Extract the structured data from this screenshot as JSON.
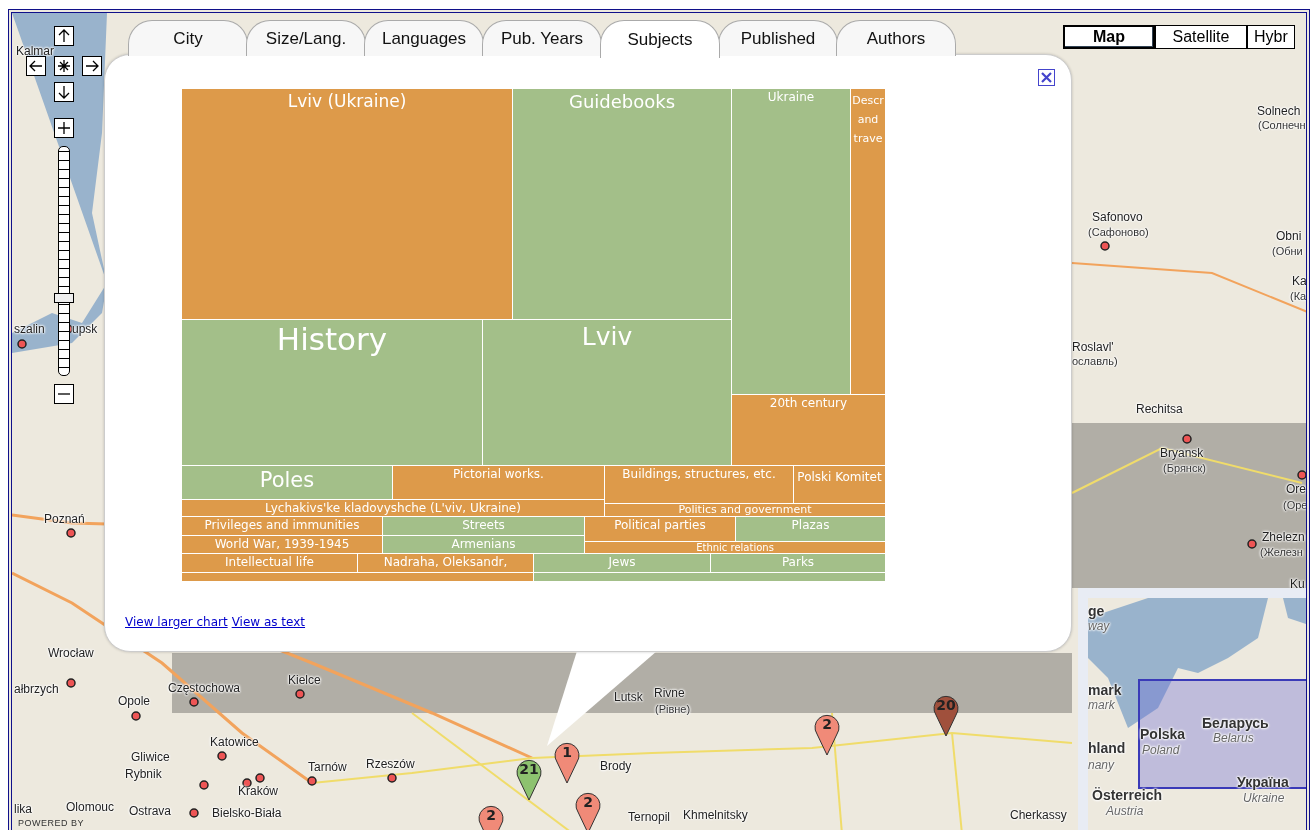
{
  "tabs": [
    {
      "label": "City",
      "selected": false
    },
    {
      "label": "Size/Lang.",
      "selected": false
    },
    {
      "label": "Languages",
      "selected": false
    },
    {
      "label": "Pub. Years",
      "selected": false
    },
    {
      "label": "Subjects",
      "selected": true
    },
    {
      "label": "Published",
      "selected": false
    },
    {
      "label": "Authors",
      "selected": false
    }
  ],
  "map_type_buttons": [
    {
      "label": "Map",
      "selected": true
    },
    {
      "label": "Satellite",
      "selected": false
    },
    {
      "label": "Hybr",
      "selected": false
    }
  ],
  "zoom_slider": {
    "level": 0.33
  },
  "info_window": {
    "treemap": {
      "cells": [
        {
          "label": "Lviv (Ukraine)",
          "color": "#dd9a4a"
        },
        {
          "label": "Guidebooks",
          "color": "#a3bf89"
        },
        {
          "label": "Ukraine",
          "color": "#a3bf89"
        },
        {
          "label": "Descr and trave",
          "color": "#dd9a4a"
        },
        {
          "label": "History",
          "color": "#a3bf89"
        },
        {
          "label": "Lviv",
          "color": "#a3bf89"
        },
        {
          "label": "20th century",
          "color": "#dd9a4a"
        },
        {
          "label": "Poles",
          "color": "#a3bf89"
        },
        {
          "label": "Pictorial works.",
          "color": "#dd9a4a"
        },
        {
          "label": "Buildings, structures, etc.",
          "color": "#dd9a4a"
        },
        {
          "label": "Polski Komitet",
          "color": "#dd9a4a"
        },
        {
          "label": "Lychakivs'ke kladovyshche (L'viv, Ukraine)",
          "color": "#dd9a4a"
        },
        {
          "label": "Politics and government",
          "color": "#dd9a4a"
        },
        {
          "label": "Privileges and immunities",
          "color": "#dd9a4a"
        },
        {
          "label": "Streets",
          "color": "#a3bf89"
        },
        {
          "label": "Political parties",
          "color": "#dd9a4a"
        },
        {
          "label": "Plazas",
          "color": "#a3bf89"
        },
        {
          "label": "World War, 1939-1945",
          "color": "#dd9a4a"
        },
        {
          "label": "Armenians",
          "color": "#a3bf89"
        },
        {
          "label": "Ethnic relations",
          "color": "#dd9a4a"
        },
        {
          "label": "Intellectual life",
          "color": "#dd9a4a"
        },
        {
          "label": "Nadraha, Oleksandr,",
          "color": "#dd9a4a"
        },
        {
          "label": "Jews",
          "color": "#a3bf89"
        },
        {
          "label": "Parks",
          "color": "#a3bf89"
        },
        {
          "color": "#dd9a4a"
        },
        {
          "color": "#a3bf89"
        }
      ]
    },
    "links": [
      "View larger chart",
      "View as text"
    ]
  },
  "markers": [
    {
      "count": "21",
      "color": "#8dc26f"
    },
    {
      "count": "1",
      "color": "#f08a78"
    },
    {
      "count": "2",
      "color": "#f08a78"
    },
    {
      "count": "2",
      "color": "#f08a78"
    },
    {
      "count": "2",
      "color": "#f08a78"
    },
    {
      "count": "20",
      "color": "#a0503c"
    }
  ],
  "map_labels": [
    {
      "text": "Kalmar",
      "kind": "city"
    },
    {
      "text": "szalin",
      "kind": "city"
    },
    {
      "text": "upsk",
      "kind": "city"
    },
    {
      "text": "Poznań",
      "kind": "city"
    },
    {
      "text": "Wrocław",
      "kind": "city"
    },
    {
      "text": "ałbrzych",
      "kind": "city"
    },
    {
      "text": "Opole",
      "kind": "city"
    },
    {
      "text": "Częstochowa",
      "kind": "city"
    },
    {
      "text": "Kielce",
      "kind": "city"
    },
    {
      "text": "Katowice",
      "kind": "city"
    },
    {
      "text": "Gliwice",
      "kind": "city"
    },
    {
      "text": "Rybnik",
      "kind": "city"
    },
    {
      "text": "Tarnów",
      "kind": "city"
    },
    {
      "text": "Rzeszów",
      "kind": "city"
    },
    {
      "text": "Kraków",
      "kind": "city"
    },
    {
      "text": "lika",
      "kind": "city"
    },
    {
      "text": "Olomouc",
      "kind": "city"
    },
    {
      "text": "Ostrava",
      "kind": "city"
    },
    {
      "text": "Bielsko-Biała",
      "kind": "city"
    },
    {
      "text": "Lutsk",
      "kind": "city"
    },
    {
      "text": "Rivne",
      "kind": "city"
    },
    {
      "text": "(Рівне)",
      "kind": "native"
    },
    {
      "text": "Brody",
      "kind": "city"
    },
    {
      "text": "Ternopil",
      "kind": "city"
    },
    {
      "text": "Khmelnitsky",
      "kind": "city"
    },
    {
      "text": "Cherkassy",
      "kind": "city"
    },
    {
      "text": "Solnech",
      "kind": "city"
    },
    {
      "text": "(Солнечн",
      "kind": "native"
    },
    {
      "text": "Safonovo",
      "kind": "city"
    },
    {
      "text": "(Сафоново)",
      "kind": "native"
    },
    {
      "text": "Obni",
      "kind": "city"
    },
    {
      "text": "(Обни",
      "kind": "native"
    },
    {
      "text": "Ka",
      "kind": "city"
    },
    {
      "text": "(Ка",
      "kind": "native"
    },
    {
      "text": "Roslavl'",
      "kind": "city"
    },
    {
      "text": "ославль)",
      "kind": "native"
    },
    {
      "text": "Rechitsa",
      "kind": "city"
    },
    {
      "text": "Bryansk",
      "kind": "city"
    },
    {
      "text": "(Брянск)",
      "kind": "native"
    },
    {
      "text": "Ore",
      "kind": "city"
    },
    {
      "text": "(Оре",
      "kind": "native"
    },
    {
      "text": "Zhelezn",
      "kind": "city"
    },
    {
      "text": "(Железн",
      "kind": "native"
    },
    {
      "text": "Ku",
      "kind": "city"
    }
  ],
  "credit": "POWERED BY",
  "overview_map": {
    "labels": [
      {
        "text": "ge",
        "kind": "country"
      },
      {
        "text": "way",
        "kind": "country-native"
      },
      {
        "text": "mark",
        "kind": "country"
      },
      {
        "text": "mark",
        "kind": "country-native"
      },
      {
        "text": "hland",
        "kind": "country"
      },
      {
        "text": "nany",
        "kind": "country-native"
      },
      {
        "text": "Polska",
        "kind": "country"
      },
      {
        "text": "Poland",
        "kind": "country-native"
      },
      {
        "text": "Беларусь",
        "kind": "country"
      },
      {
        "text": "Belarus",
        "kind": "country-native"
      },
      {
        "text": "Україна",
        "kind": "country"
      },
      {
        "text": "Ukraine",
        "kind": "country-native"
      },
      {
        "text": "Österreich",
        "kind": "country"
      },
      {
        "text": "Austria",
        "kind": "country-native"
      }
    ]
  }
}
